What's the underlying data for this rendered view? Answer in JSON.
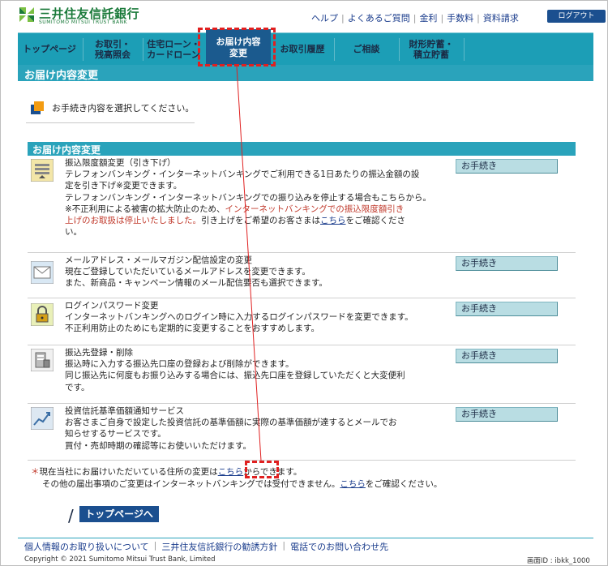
{
  "header": {
    "bank_name": "三井住友信託銀行",
    "bank_name_en": "SUMITOMO MITSUI TRUST BANK",
    "util_links": [
      "ヘルプ",
      "よくあるご質問",
      "金利",
      "手数料",
      "資料請求"
    ],
    "logout": "ログアウト"
  },
  "gnav": {
    "items": [
      {
        "label": "トップページ"
      },
      {
        "label": "お取引・\n残高照会"
      },
      {
        "label": "住宅ローン・\nカードローン"
      },
      {
        "label": "お届け内容\n変更"
      },
      {
        "label": "お取引履歴"
      },
      {
        "label": "ご相談"
      },
      {
        "label": "財形貯蓄・\n積立貯蓄"
      }
    ],
    "active_index": 3
  },
  "page": {
    "title": "お届け内容変更",
    "instruction": "お手続き内容を選択してください。",
    "section_title": "お届け内容変更",
    "procedure_button": "お手続き"
  },
  "rows": [
    {
      "icon": "transfer-limit-icon",
      "title": "振込限度額変更（引き下げ）",
      "lines": [
        "テレフォンバンキング・インターネットバンキングでご利用できる1日あたりの振込金額の設",
        "定を引き下げ※変更できます。",
        "テレフォンバンキング・インターネットバンキングでの振り込みを停止する場合もこちらから。"
      ],
      "note_prefix": "※不正利用による被害の拡大防止のため、",
      "note_red1": "インターネットバンキングでの振込限度額引き",
      "note_red2": "上げのお取扱は停止いたしました。",
      "note_after": "引き上げをご希望のお客さまは",
      "note_link": "こちら",
      "note_suffix": "をご確認くださ",
      "note_end": "い。"
    },
    {
      "icon": "mail-icon",
      "title": "メールアドレス・メールマガジン配信設定の変更",
      "lines": [
        "現在ご登録していただいているメールアドレスを変更できます。",
        "また、新商品・キャンペーン情報のメール配信要否も選択できます。"
      ]
    },
    {
      "icon": "lock-icon",
      "title": "ログインパスワード変更",
      "lines": [
        "インターネットバンキングへのログイン時に入力するログインパスワードを変更できます。",
        "不正利用防止のためにも定期的に変更することをおすすめします。"
      ]
    },
    {
      "icon": "payee-register-icon",
      "title": "振込先登録・削除",
      "lines": [
        "振込時に入力する振込先口座の登録および削除ができます。",
        "同じ振込先に何度もお振り込みする場合には、振込先口座を登録していただくと大変便利",
        "です。"
      ]
    },
    {
      "icon": "chart-trend-icon",
      "title": "投資信託基準価額通知サービス",
      "lines": [
        "お客さまご自身で設定した投資信託の基準価額に実際の基準価額が達するとメールでお",
        "知らせするサービスです。",
        "買付・売却時期の確認等にお使いいただけます。"
      ]
    }
  ],
  "notes": {
    "star": "＊",
    "line1_prefix": "現在当社にお届けいただいている住所の変更は",
    "line1_link": "こちら",
    "line1_suffix": "からできます。",
    "line2_prefix": "その他の届出事項のご変更はインターネットバンキングでは受付できません。",
    "line2_link": "こちら",
    "line2_suffix": "をご確認ください。"
  },
  "top_button": "トップページへ",
  "footer": {
    "links": [
      "個人情報のお取り扱いについて",
      "三井住友信託銀行の勧誘方針",
      "電話でのお問い合わせ先"
    ],
    "copyright": "Copyright © 2021 Sumitomo Mitsui Trust Bank, Limited",
    "screen_id": "画面ID : ibkk_1000"
  },
  "colors": {
    "nav_bg": "#1c9eb6",
    "nav_active": "#1b5a8e",
    "annotation": "#e02020",
    "brand_green": "#1a7a3a"
  }
}
